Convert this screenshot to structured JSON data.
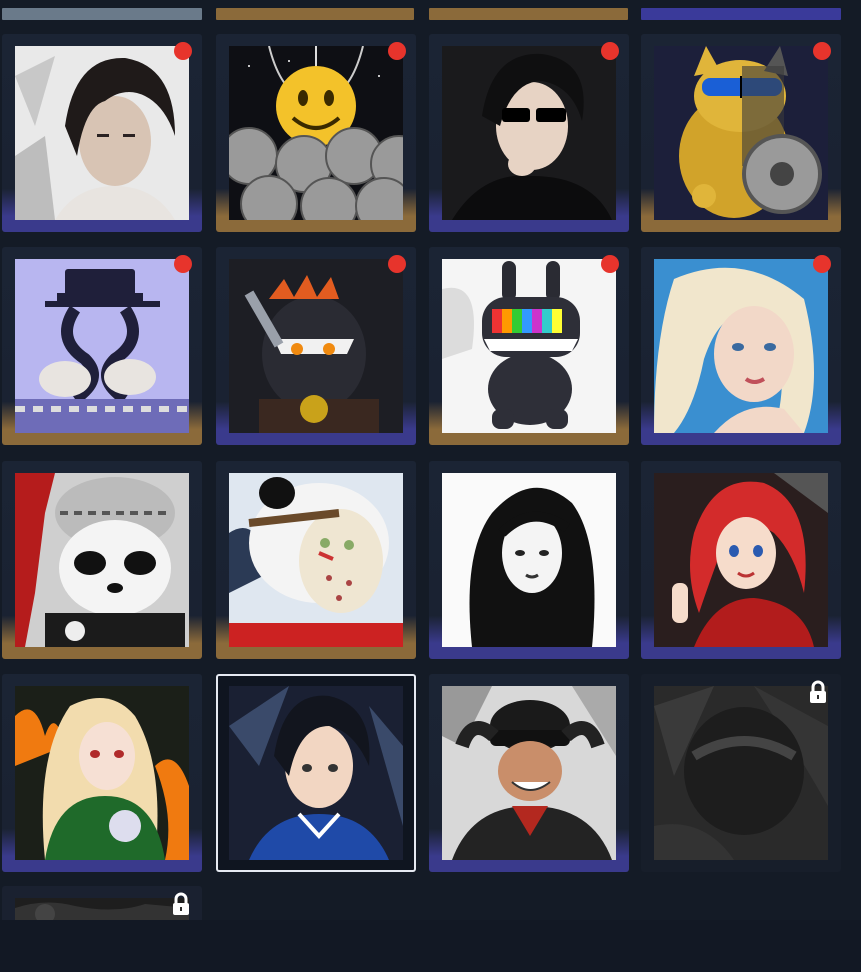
{
  "colors": {
    "background": "#141b26",
    "rim_purple": "#3a3a8c",
    "rim_gold": "#8b6a3a",
    "badge_red": "#e7342c",
    "selected_outline": "#e6eaf2"
  },
  "top_strips": [
    {
      "color": "#6a7a8a"
    },
    {
      "color": "#8b6a3a"
    },
    {
      "color": "#8b6a3a"
    },
    {
      "color": "#3a3a9a"
    }
  ],
  "avatars": [
    {
      "name": "dark-haired-man-portrait",
      "rim": "purple",
      "badge": true,
      "locked": false,
      "selected": false
    },
    {
      "name": "smiley-face-balloons",
      "rim": "gold",
      "badge": true,
      "locked": false,
      "selected": false
    },
    {
      "name": "sunglasses-anime-guy",
      "rim": "purple",
      "badge": true,
      "locked": false,
      "selected": false
    },
    {
      "name": "golden-lucky-cat",
      "rim": "gold",
      "badge": true,
      "locked": false,
      "selected": false
    },
    {
      "name": "robot-tentacle-machine",
      "rim": "gold",
      "badge": true,
      "locked": false,
      "selected": false
    },
    {
      "name": "mechanic-dino-creature",
      "rim": "purple",
      "badge": true,
      "locked": false,
      "selected": false
    },
    {
      "name": "tv-head-bunny-toy",
      "rim": "gold",
      "badge": true,
      "locked": false,
      "selected": false
    },
    {
      "name": "blonde-girl-portrait",
      "rim": "purple",
      "badge": true,
      "locked": false,
      "selected": false
    },
    {
      "name": "beanie-panda-graffiti",
      "rim": "gold",
      "badge": false,
      "locked": false,
      "selected": false
    },
    {
      "name": "hockey-mask-panda-car",
      "rim": "gold",
      "badge": false,
      "locked": false,
      "selected": false
    },
    {
      "name": "monochrome-long-hair-girl",
      "rim": "purple",
      "badge": false,
      "locked": false,
      "selected": false
    },
    {
      "name": "red-hair-peace-sign-girl",
      "rim": "purple",
      "badge": false,
      "locked": false,
      "selected": false
    },
    {
      "name": "blonde-girl-flames",
      "rim": "purple",
      "badge": false,
      "locked": false,
      "selected": false
    },
    {
      "name": "blue-jersey-boy",
      "rim": "purple",
      "badge": false,
      "locked": false,
      "selected": true
    },
    {
      "name": "cap-smiling-guy",
      "rim": "purple",
      "badge": false,
      "locked": false,
      "selected": false
    },
    {
      "name": "dark-helmet-locked",
      "rim": "purple",
      "badge": false,
      "locked": true,
      "selected": false
    },
    {
      "name": "partial-locked-avatar",
      "rim": "none",
      "badge": false,
      "locked": true,
      "selected": false
    }
  ]
}
